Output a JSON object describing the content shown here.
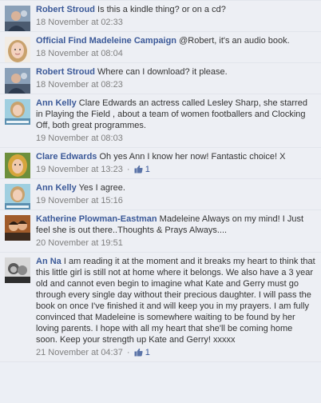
{
  "comments": [
    {
      "author": "Robert Stroud",
      "text": "Is this a kindle thing? or on a cd?",
      "timestamp": "18 November at 02:33",
      "likes": null,
      "avatar": "robert"
    },
    {
      "author": "Official Find Madeleine Campaign",
      "text": "@Robert, it's an audio book.",
      "timestamp": "18 November at 08:04",
      "likes": null,
      "avatar": "madeleine"
    },
    {
      "author": "Robert Stroud",
      "text": "Where can I download? it please.",
      "timestamp": "18 November at 08:23",
      "likes": null,
      "avatar": "robert"
    },
    {
      "author": "Ann Kelly",
      "text": "Clare Edwards an actress called Lesley Sharp, she starred in Playing the Field , about a team of women footballers and Clocking Off, both great programmes.",
      "timestamp": "19 November at 08:03",
      "likes": null,
      "avatar": "ann"
    },
    {
      "author": "Clare Edwards",
      "text": "Oh yes Ann I know her now! Fantastic choice! X",
      "timestamp": "19 November at 13:23",
      "likes": "1",
      "avatar": "clare"
    },
    {
      "author": "Ann Kelly",
      "text": "Yes I agree.",
      "timestamp": "19 November at 15:16",
      "likes": null,
      "avatar": "ann"
    },
    {
      "author": "Katherine Plowman-Eastman",
      "text": "Madeleine Always on my mind! I Just feel she is out there..Thoughts & Prays Always....",
      "timestamp": "20 November at 19:51",
      "likes": null,
      "avatar": "katherine"
    },
    {
      "author": "An Na",
      "text": "I am reading it at the moment and it breaks my heart to think that this little girl is still not at home where it belongs. We also have a 3 year old and cannot even begin to imagine what Kate and Gerry must go through every single day without their precious daughter. I will pass the book on once I've finished it and will keep you in my prayers. I am fully convinced that Madeleine is somewhere waiting to be found by her loving parents. I hope with all my heart that she'll be coming home soon. Keep your strength up Kate and Gerry! xxxxx",
      "timestamp": "21 November at 04:37",
      "likes": "1",
      "avatar": "anna"
    }
  ],
  "separator": "·",
  "colors": {
    "name": "#3b5998",
    "body": "#333333",
    "meta": "#808080",
    "background": "#edeff4"
  }
}
